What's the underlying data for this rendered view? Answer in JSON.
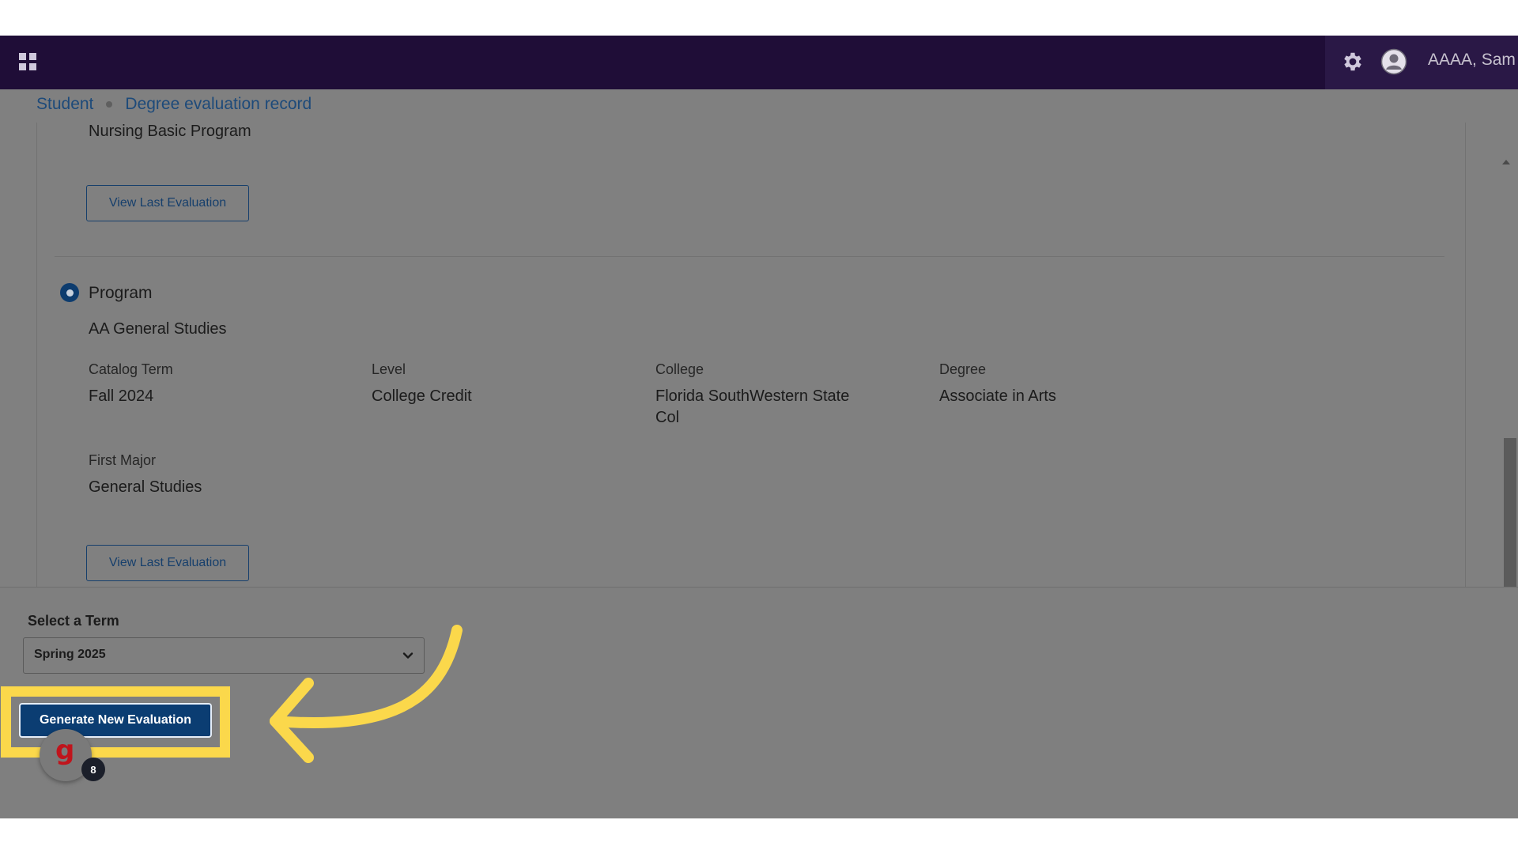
{
  "header": {
    "apps_icon": "apps-grid-icon",
    "settings_icon": "gear-icon",
    "avatar_icon": "user-avatar-icon",
    "user_name": "AAAA, Sam"
  },
  "breadcrumb": {
    "items": [
      "Student",
      "Degree evaluation record"
    ]
  },
  "previous_program": {
    "name": "Nursing Basic Program",
    "view_button": "View Last Evaluation"
  },
  "program": {
    "label": "Program",
    "selected": true,
    "name": "AA General Studies",
    "fields": {
      "catalog_term_label": "Catalog Term",
      "catalog_term_value": "Fall 2024",
      "level_label": "Level",
      "level_value": "College Credit",
      "college_label": "College",
      "college_value_line1": "Florida SouthWestern State",
      "college_value_line2": "Col",
      "degree_label": "Degree",
      "degree_value": "Associate in Arts",
      "first_major_label": "First Major",
      "first_major_value": "General Studies"
    },
    "view_button": "View Last Evaluation"
  },
  "footer": {
    "term_label": "Select a Term",
    "term_selected": "Spring 2025",
    "generate_button": "Generate New Evaluation"
  },
  "helper_widget": {
    "logo_letter": "g",
    "count": "8"
  },
  "colors": {
    "topbar": "#1f0d37",
    "link": "#1d4a7a",
    "primary": "#0b3d72",
    "highlight": "#fbd84b",
    "helper_logo": "#c0141c"
  }
}
